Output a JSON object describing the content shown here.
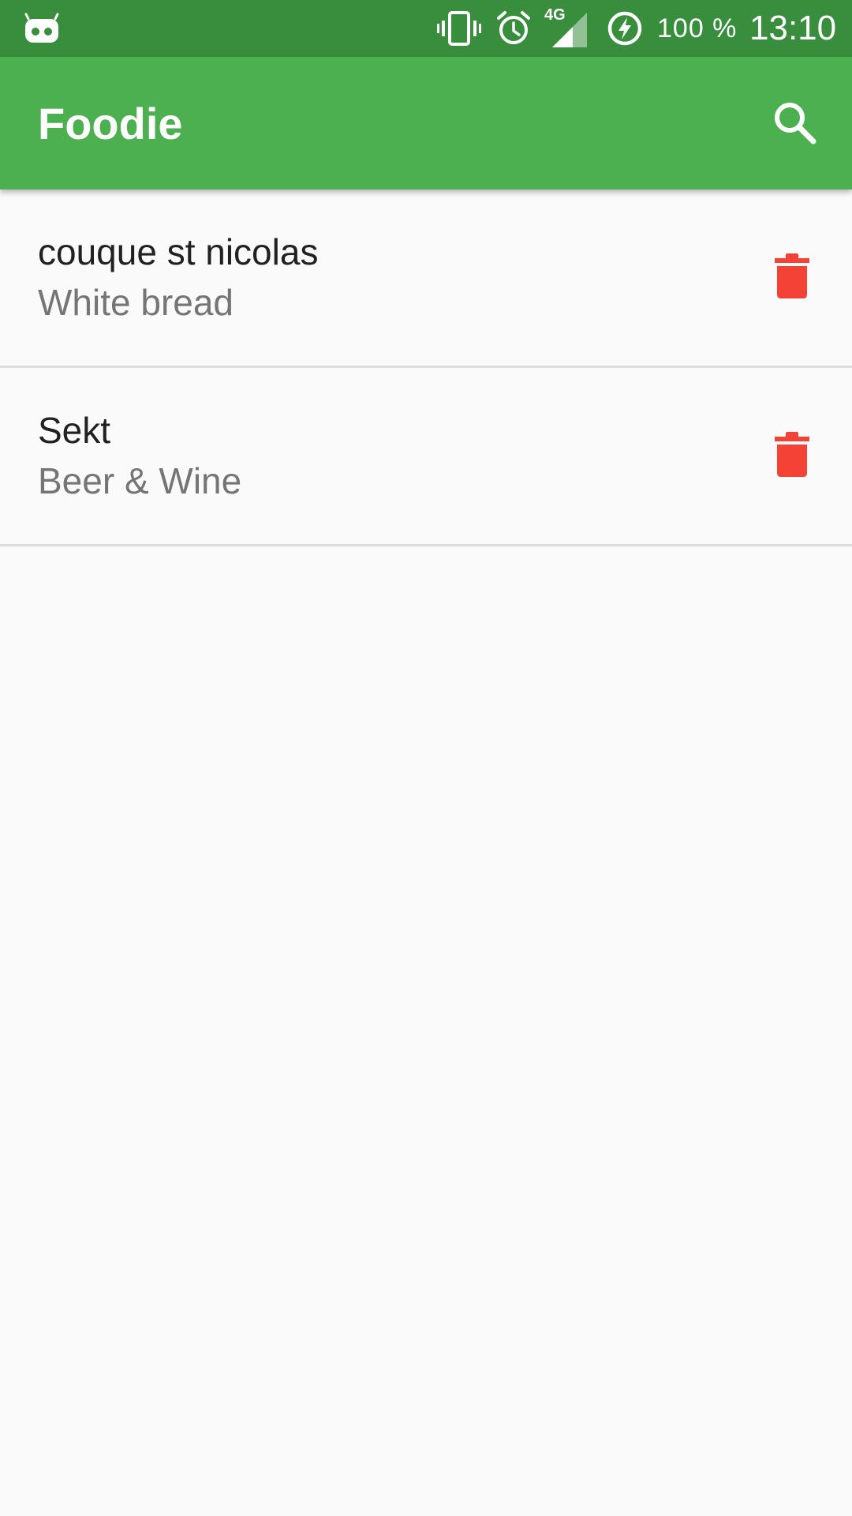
{
  "status_bar": {
    "battery_text": "100 %",
    "time": "13:10",
    "network_label": "4G",
    "icons": [
      "android-icon",
      "vibrate-icon",
      "alarm-icon",
      "signal-icon",
      "battery-charging-icon"
    ]
  },
  "app_bar": {
    "title": "Foodie",
    "search_icon": "search-icon"
  },
  "items": [
    {
      "title": "couque st nicolas",
      "category": "White bread",
      "action_icon": "delete-icon"
    },
    {
      "title": "Sekt",
      "category": "Beer & Wine",
      "action_icon": "delete-icon"
    }
  ],
  "colors": {
    "status_bar": "#388e3c",
    "app_bar": "#4caf50",
    "delete": "#f44336",
    "background": "#fafafa",
    "primary_text": "#212121",
    "secondary_text": "#757575",
    "divider": "#dcdcdc"
  }
}
